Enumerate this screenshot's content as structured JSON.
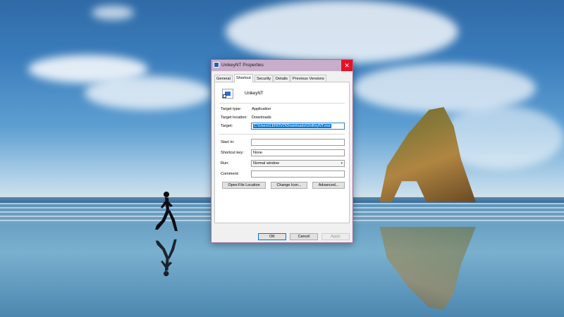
{
  "dialog": {
    "title": "UnikeyNT Properties",
    "close_glyph": "✕",
    "tabs": [
      {
        "label": "General"
      },
      {
        "label": "Shortcut"
      },
      {
        "label": "Security"
      },
      {
        "label": "Details"
      },
      {
        "label": "Previous Versions"
      }
    ],
    "active_tab": "Shortcut",
    "app_name": "UnikeyNT",
    "fields": {
      "target_type_label": "Target type:",
      "target_type_value": "Application",
      "target_location_label": "Target location:",
      "target_location_value": "Downloads",
      "target_label": "Target:",
      "target_value": "C:\\Users\\LENOVO\\Downloads\\UniKeyNT.exe",
      "start_in_label": "Start in:",
      "start_in_value": "",
      "shortcut_key_label": "Shortcut key:",
      "shortcut_key_value": "None",
      "run_label": "Run:",
      "run_value": "Normal window",
      "comment_label": "Comment:",
      "comment_value": ""
    },
    "buttons": {
      "open_file_location": "Open File Location",
      "change_icon": "Change Icon...",
      "advanced": "Advanced...",
      "ok": "OK",
      "cancel": "Cancel",
      "apply": "Apply"
    },
    "icons": {
      "title_icon": "shortcut-app-icon",
      "app_icon": "shortcut-app-icon",
      "run_dropdown": "chevron-down-icon"
    },
    "colors": {
      "titlebar": "#c8aecb",
      "close": "#e81123",
      "selection": "#0078d7"
    }
  }
}
